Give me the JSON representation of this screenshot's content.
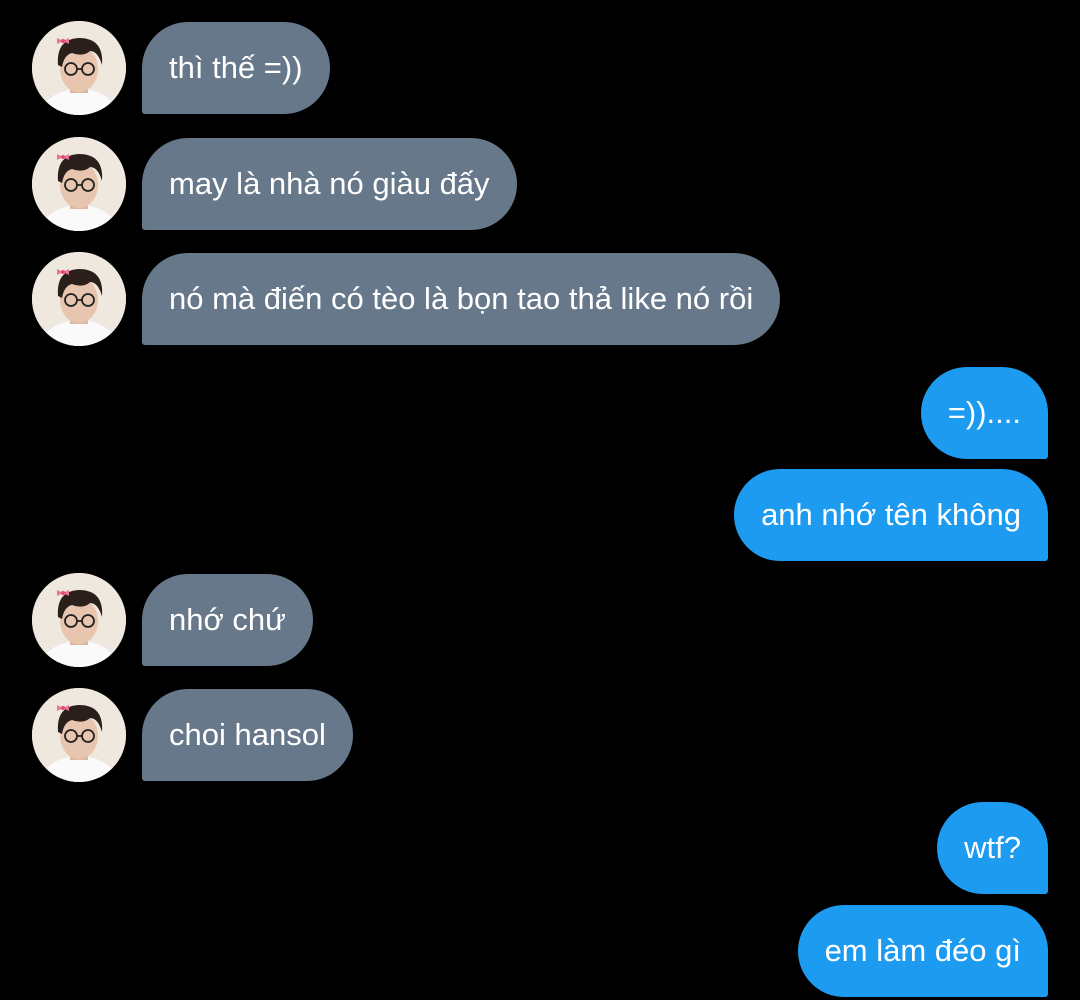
{
  "conversation": {
    "messages": [
      {
        "direction": "incoming",
        "text": "thì thế =))"
      },
      {
        "direction": "incoming",
        "text": "may là nhà nó giàu đấy"
      },
      {
        "direction": "incoming",
        "text": "nó mà điến có tèo là bọn tao thả like nó rồi"
      },
      {
        "direction": "outgoing",
        "text": "=))...."
      },
      {
        "direction": "outgoing",
        "text": "anh nhớ tên không"
      },
      {
        "direction": "incoming",
        "text": "nhớ chứ"
      },
      {
        "direction": "incoming",
        "text": "choi hansol"
      },
      {
        "direction": "outgoing",
        "text": "wtf?"
      },
      {
        "direction": "outgoing",
        "text": "em làm đéo gì"
      }
    ]
  },
  "colors": {
    "background": "#000000",
    "incoming_bubble": "#66788a",
    "outgoing_bubble": "#1d9bf0",
    "text": "#ffffff"
  },
  "icons": {
    "avatar": "profile-photo-avatar"
  }
}
